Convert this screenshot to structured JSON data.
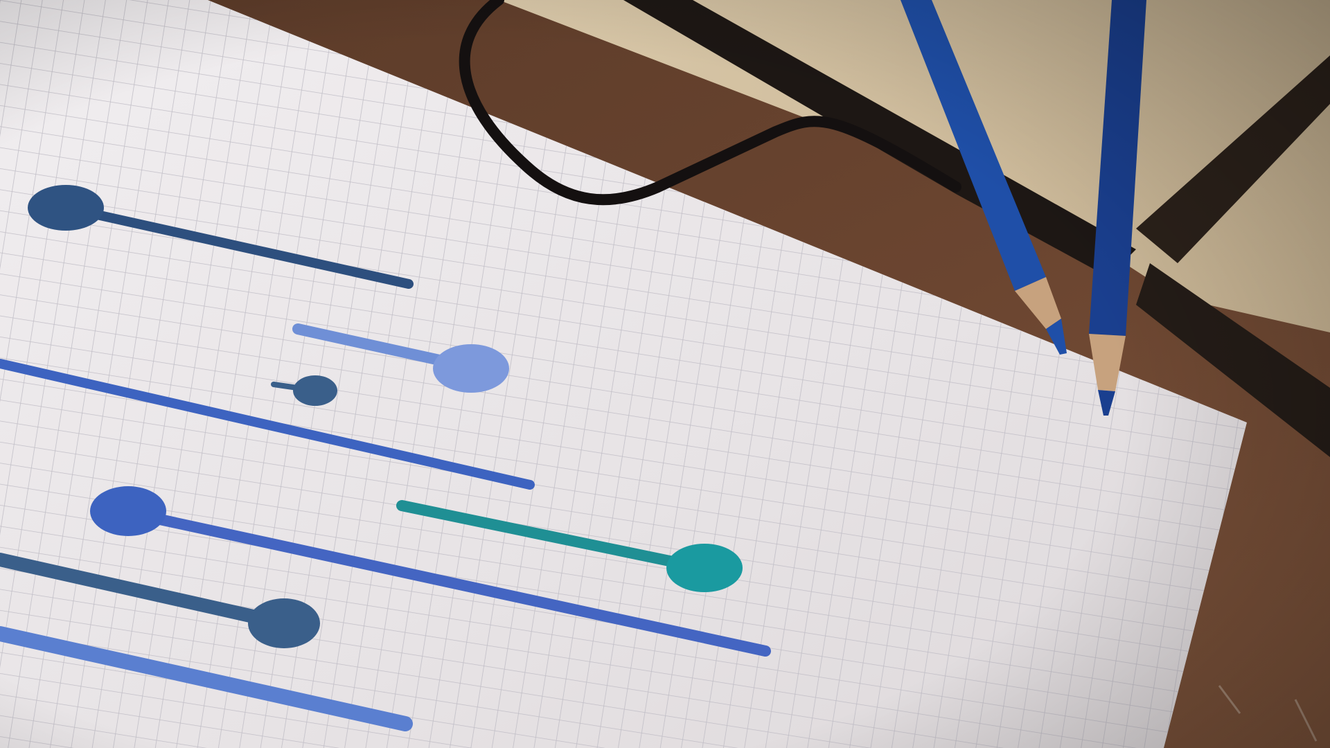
{
  "scene": {
    "kind": "photograph",
    "colors": {
      "table": "#6b4530",
      "table_light": "#8a6048",
      "paper": "#e9e5e6",
      "grid_line": "#b9b6bf",
      "clip_black": "#1d1714",
      "elastic_band": "#141010",
      "pencil_blue": "#1f4fa8",
      "pencil_dark_blue": "#1a3f8f",
      "pencil_wood": "#c7a27e",
      "stroke_navy": "#2d4f7e",
      "stroke_light_blue": "#6f8fd6",
      "stroke_slate": "#3a5f8a",
      "stroke_royal": "#3d63c0",
      "stroke_teal": "#1f8f94",
      "stroke_periwinkle": "#5a7fd0"
    },
    "drawing": {
      "description_items": [
        {
          "name": "lollipop-stroke-1",
          "color_key": "stroke_navy"
        },
        {
          "name": "lollipop-stroke-2",
          "color_key": "stroke_light_blue"
        },
        {
          "name": "long-stroke-3",
          "color_key": "stroke_royal"
        },
        {
          "name": "small-dot-stroke-4",
          "color_key": "stroke_slate"
        },
        {
          "name": "lollipop-stroke-5",
          "color_key": "stroke_royal"
        },
        {
          "name": "lollipop-stroke-6",
          "color_key": "stroke_teal"
        },
        {
          "name": "lollipop-stroke-7",
          "color_key": "stroke_slate"
        },
        {
          "name": "long-stroke-8",
          "color_key": "stroke_periwinkle"
        }
      ]
    },
    "pencils": [
      {
        "name": "blue-pencil-left",
        "color_key": "pencil_blue"
      },
      {
        "name": "blue-pencil-right",
        "color_key": "pencil_dark_blue"
      }
    ]
  }
}
